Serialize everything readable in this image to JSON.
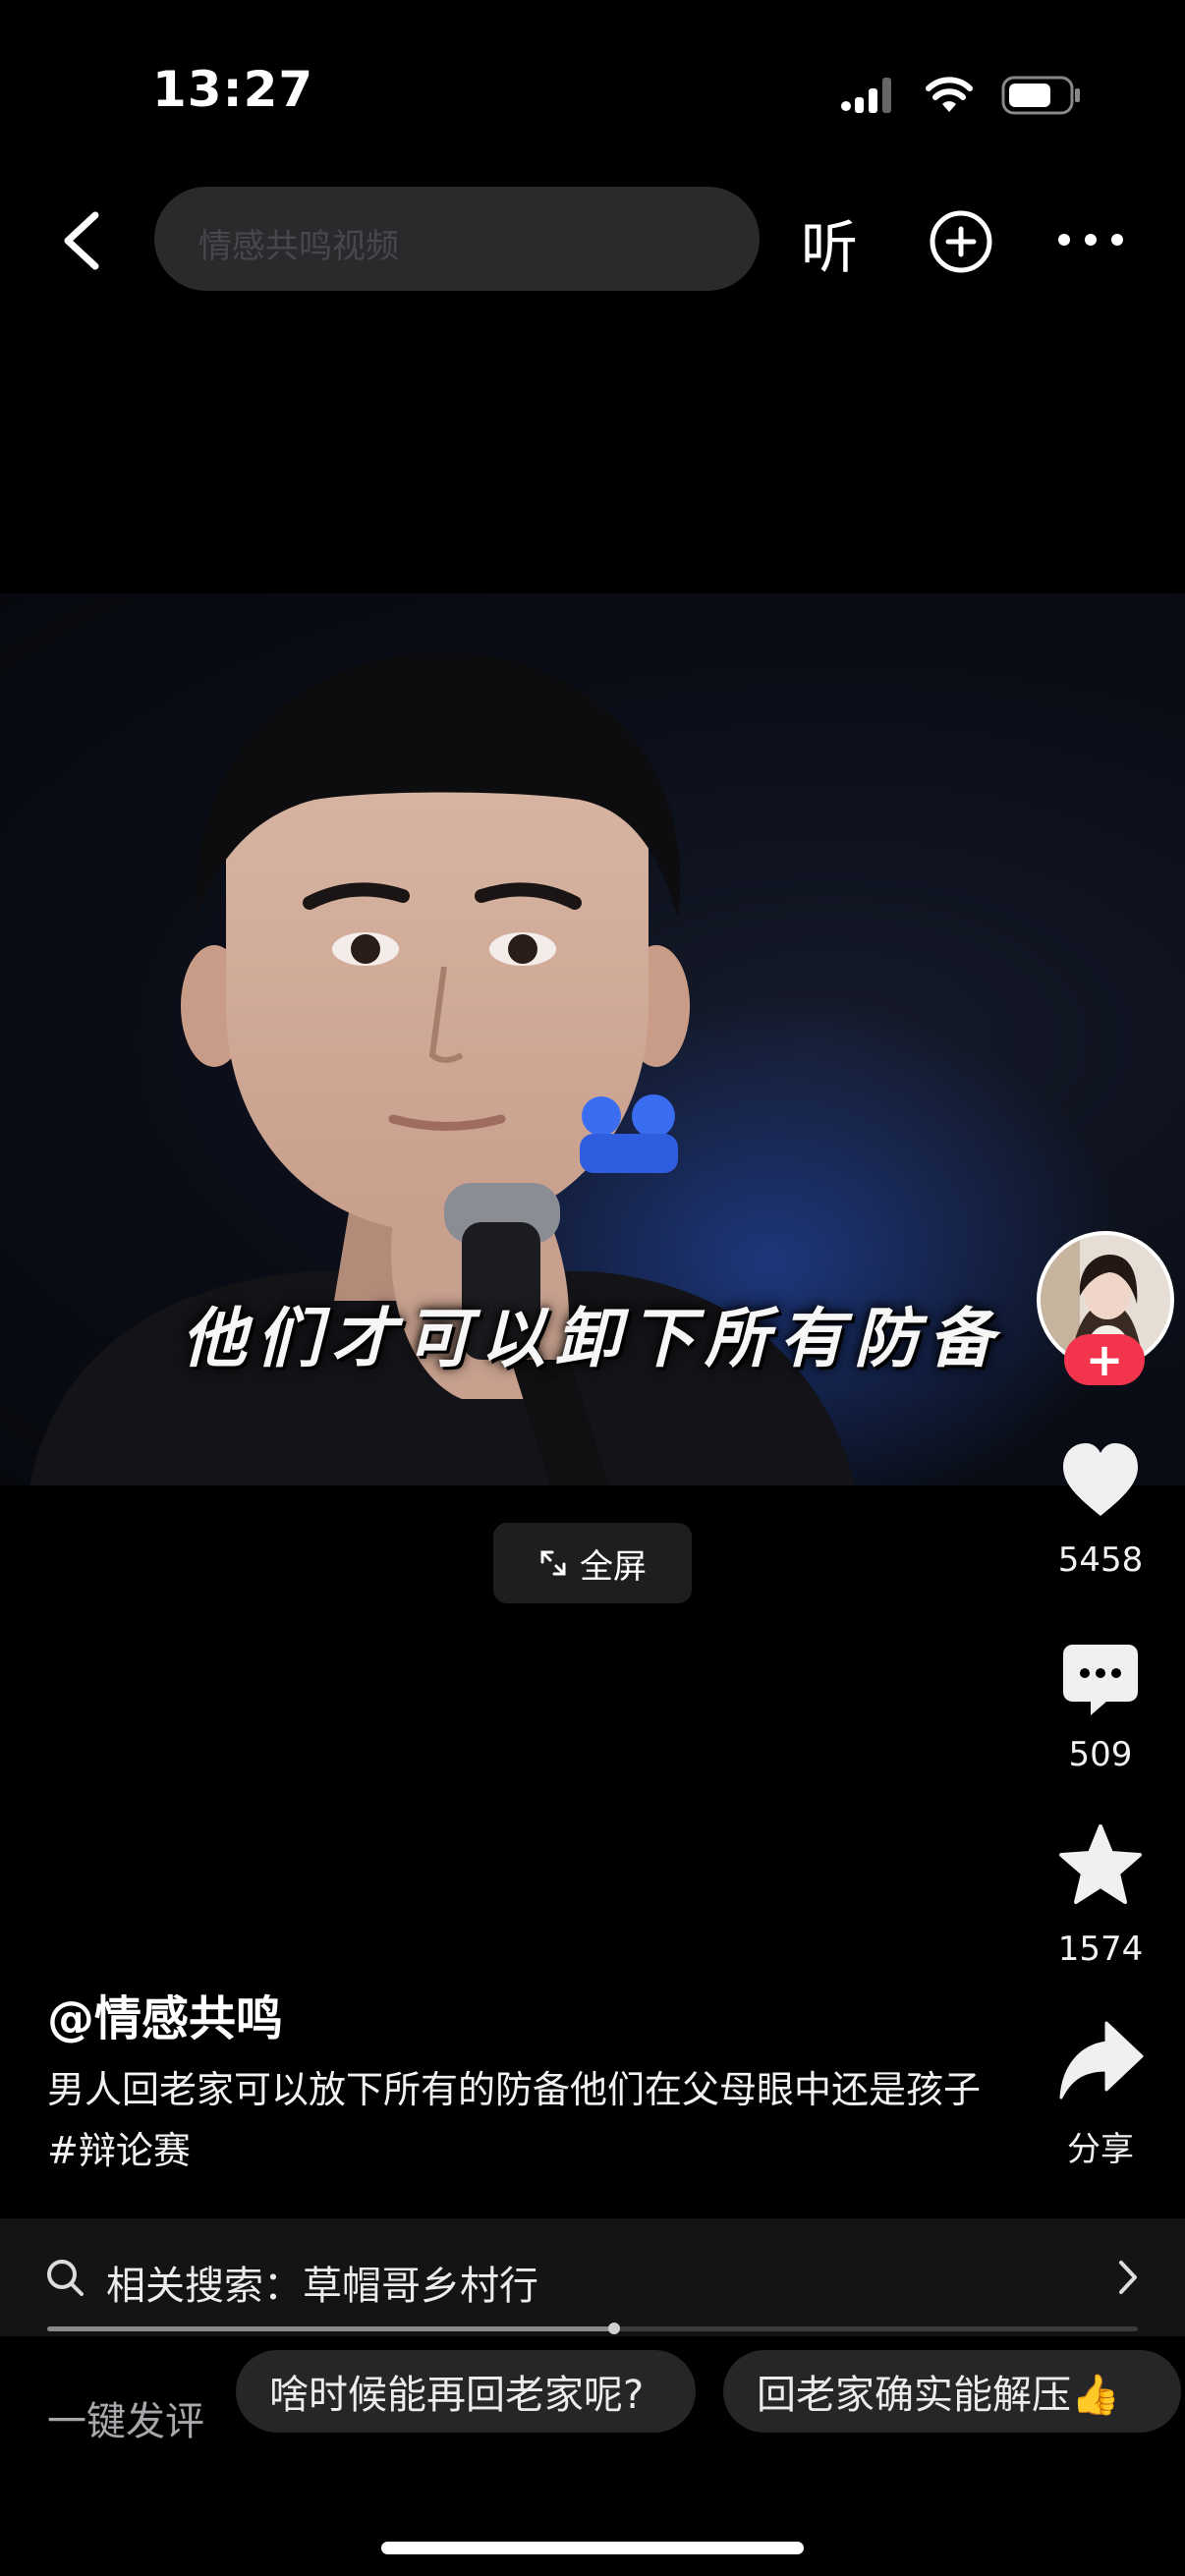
{
  "status": {
    "time": "13:27"
  },
  "nav": {
    "search_placeholder": "情感共鸣视频",
    "listen_label": "听"
  },
  "video": {
    "subtitle": "他们才可以卸下所有防备",
    "fullscreen_label": "全屏"
  },
  "rail": {
    "like_count": "5458",
    "comment_count": "509",
    "favorite_count": "1574",
    "share_label": "分享",
    "colors": {
      "follow": "#f2354d"
    }
  },
  "post": {
    "author": "@情感共鸣",
    "caption": "男人回老家可以放下所有的防备他们在父母眼中还是孩子#辩论赛"
  },
  "related": {
    "label": "相关搜索：草帽哥乡村行",
    "progress": 0.52
  },
  "quick_comment": {
    "label": "一键发评",
    "chips": [
      "啥时候能再回老家呢?",
      "回老家确实能解压👍"
    ]
  },
  "icons": [
    "back-icon",
    "search-icon",
    "plus-circle-icon",
    "more-icon",
    "heart-icon",
    "comment-icon",
    "star-icon",
    "share-icon",
    "chevron-right-icon",
    "expand-icon",
    "signal-icon",
    "wifi-icon",
    "battery-icon"
  ]
}
